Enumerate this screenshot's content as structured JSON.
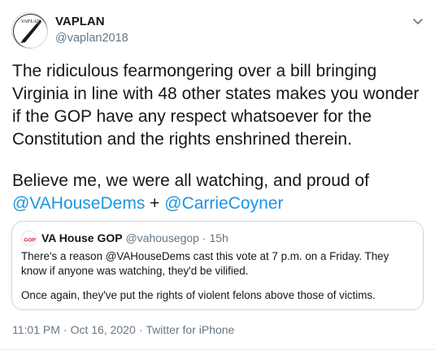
{
  "tweet": {
    "author": {
      "display_name": "VAPLAN",
      "handle": "@vaplan2018",
      "avatar_text": "VAPLAN"
    },
    "text_line1": "The ridiculous fearmongering over a bill bringing Virginia in line with 48 other states makes you wonder if the GOP have any respect whatsoever for the Constitution and the rights enshrined therein.",
    "text_line2_prefix": "Believe me, we were all watching, and proud of ",
    "mention1": "@VAHouseDems",
    "plus": " + ",
    "mention2": "@CarrieCoyner",
    "icon_more": "chevron-down-icon"
  },
  "quoted": {
    "avatar_text": "GOP",
    "display_name": "VA House GOP",
    "handle": "@vahousegop",
    "dot": "·",
    "time": "15h",
    "text1": "There's a reason @VAHouseDems cast this vote at 7 p.m. on a Friday. They know if anyone was watching, they'd be vilified.",
    "text2": "Once again, they've put the rights of violent felons above those of victims."
  },
  "meta": {
    "time": "11:01 PM",
    "dot": "·",
    "date": "Oct 16, 2020",
    "dot2": "·",
    "source": "Twitter for iPhone"
  },
  "colors": {
    "link": "#1b95e0",
    "secondary": "#657786",
    "border": "#ccd6dd",
    "gop_red": "#d6212b"
  }
}
